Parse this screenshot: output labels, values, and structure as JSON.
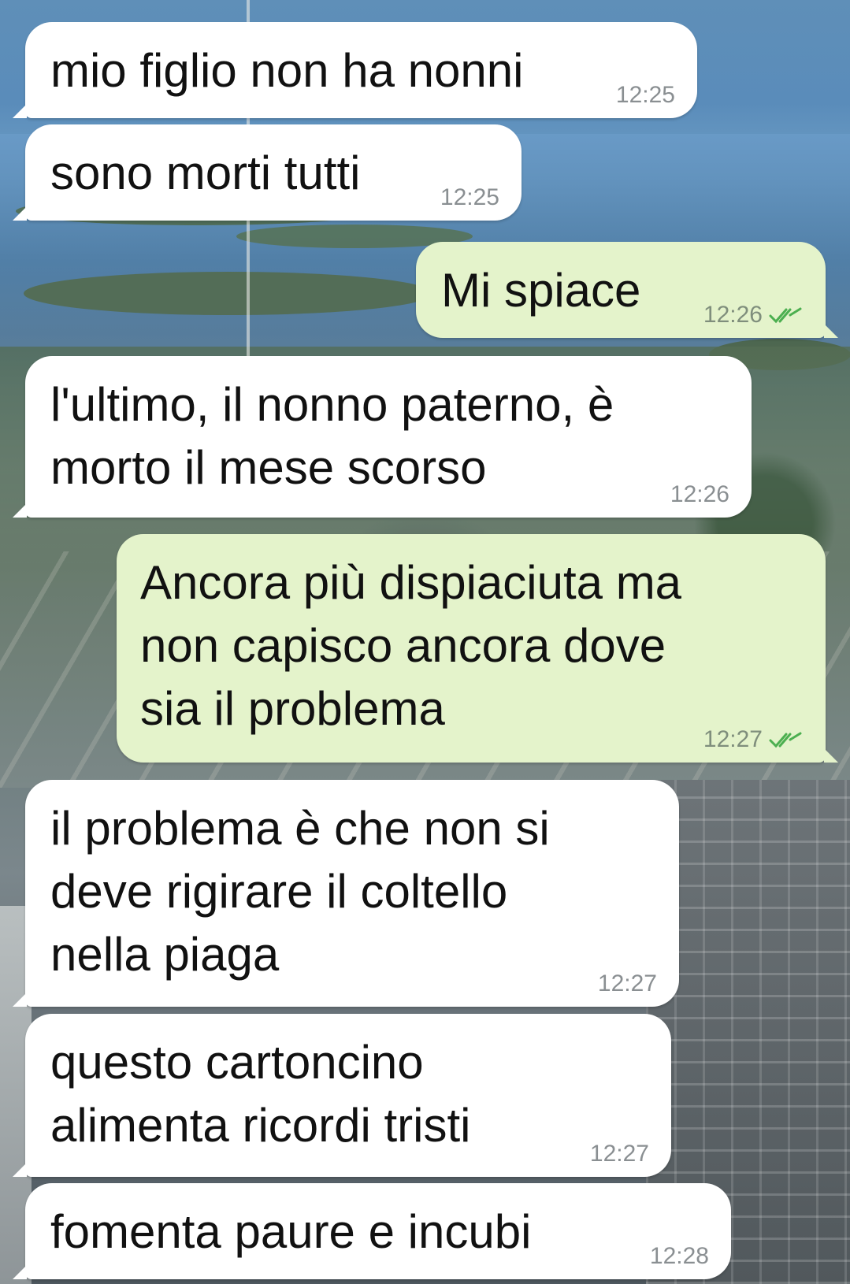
{
  "chat": {
    "messages": [
      {
        "direction": "incoming",
        "text": "mio figlio non ha nonni",
        "time": "12:25"
      },
      {
        "direction": "incoming",
        "text": "sono morti tutti",
        "time": "12:25"
      },
      {
        "direction": "outgoing",
        "text": "Mi spiace",
        "time": "12:26",
        "read_status": "read"
      },
      {
        "direction": "incoming",
        "text": "l'ultimo, il nonno paterno, è\nmorto il mese scorso",
        "time": "12:26"
      },
      {
        "direction": "outgoing",
        "text": "Ancora più dispiaciuta ma\nnon capisco ancora dove\nsia il problema",
        "time": "12:27",
        "read_status": "read"
      },
      {
        "direction": "incoming",
        "text": "il problema è che non si\ndeve rigirare il coltello\nnella piaga",
        "time": "12:27"
      },
      {
        "direction": "incoming",
        "text": "questo cartoncino\nalimenta ricordi tristi",
        "time": "12:27"
      },
      {
        "direction": "incoming",
        "text": "fomenta paure e incubi",
        "time": "12:28"
      }
    ]
  },
  "colors": {
    "incoming_bubble": "#ffffff",
    "outgoing_bubble": "#e4f3cb",
    "read_check": "#4caf50"
  },
  "icons": {
    "read_receipt": "double-check-icon"
  }
}
